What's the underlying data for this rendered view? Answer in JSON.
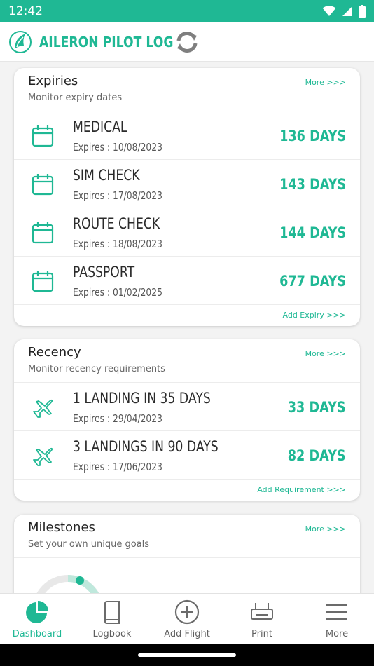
{
  "status_bar": {
    "time": "12:42",
    "icons": [
      "wifi-icon",
      "signal-icon",
      "battery-icon"
    ]
  },
  "app_bar": {
    "title": "AILERON PILOT LOG",
    "logo_icon": "wing-logo-icon",
    "action_icon": "sync-icon"
  },
  "colors": {
    "accent": "#1fb894",
    "text": "#2b2b2b",
    "muted": "#666666",
    "card_bg": "#ffffff",
    "page_bg": "#f3f3f3"
  },
  "expiries": {
    "title": "Expiries",
    "subtitle": "Monitor expiry dates",
    "more": "More >>>",
    "add": "Add Expiry >>>",
    "items": [
      {
        "name": "MEDICAL",
        "expires": "Expires : 10/08/2023",
        "days": "136 DAYS",
        "icon": "calendar-icon"
      },
      {
        "name": "SIM CHECK",
        "expires": "Expires : 17/08/2023",
        "days": "143 DAYS",
        "icon": "calendar-icon"
      },
      {
        "name": "ROUTE CHECK",
        "expires": "Expires : 18/08/2023",
        "days": "144 DAYS",
        "icon": "calendar-icon"
      },
      {
        "name": "PASSPORT",
        "expires": "Expires : 01/02/2025",
        "days": "677 DAYS",
        "icon": "calendar-icon"
      }
    ]
  },
  "recency": {
    "title": "Recency",
    "subtitle": "Monitor recency requirements",
    "more": "More >>>",
    "add": "Add Requirement >>>",
    "items": [
      {
        "name": "1 LANDING IN 35 DAYS",
        "expires": "Expires : 29/04/2023",
        "days": "33 DAYS",
        "icon": "airplane-icon"
      },
      {
        "name": "3 LANDINGS IN 90 DAYS",
        "expires": "Expires : 17/06/2023",
        "days": "82 DAYS",
        "icon": "airplane-icon"
      }
    ]
  },
  "milestones": {
    "title": "Milestones",
    "subtitle": "Set your own unique goals",
    "more": "More >>>"
  },
  "bottom_nav": [
    {
      "label": "Dashboard",
      "icon": "pie-chart-icon",
      "active": true
    },
    {
      "label": "Logbook",
      "icon": "book-icon",
      "active": false
    },
    {
      "label": "Add Flight",
      "icon": "plus-circle-icon",
      "active": false
    },
    {
      "label": "Print",
      "icon": "printer-icon",
      "active": false
    },
    {
      "label": "More",
      "icon": "menu-icon",
      "active": false
    }
  ]
}
